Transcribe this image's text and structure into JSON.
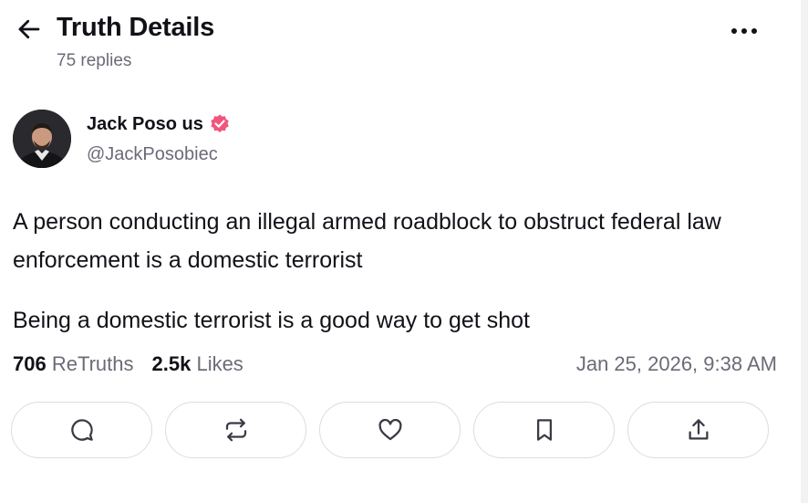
{
  "header": {
    "title": "Truth Details",
    "replies_text": "75 replies",
    "back_icon": "arrow-left-icon",
    "more_icon": "more-horizontal-icon"
  },
  "author": {
    "name": "Jack Poso us",
    "handle": "@JackPosobiec",
    "verified": true,
    "verified_color": "#f0557d"
  },
  "post": {
    "paragraphs": [
      "A person conducting an illegal armed roadblock to obstruct federal law enforcement is a domestic terrorist",
      "Being a domestic terrorist is a good way to get shot"
    ],
    "retruths_count": "706",
    "retruths_label": "ReTruths",
    "likes_count": "2.5k",
    "likes_label": "Likes",
    "timestamp": "Jan 25, 2026, 9:38 AM"
  },
  "actions": [
    {
      "icon": "reply-icon"
    },
    {
      "icon": "retruth-icon"
    },
    {
      "icon": "like-icon"
    },
    {
      "icon": "bookmark-icon"
    },
    {
      "icon": "share-icon"
    }
  ]
}
